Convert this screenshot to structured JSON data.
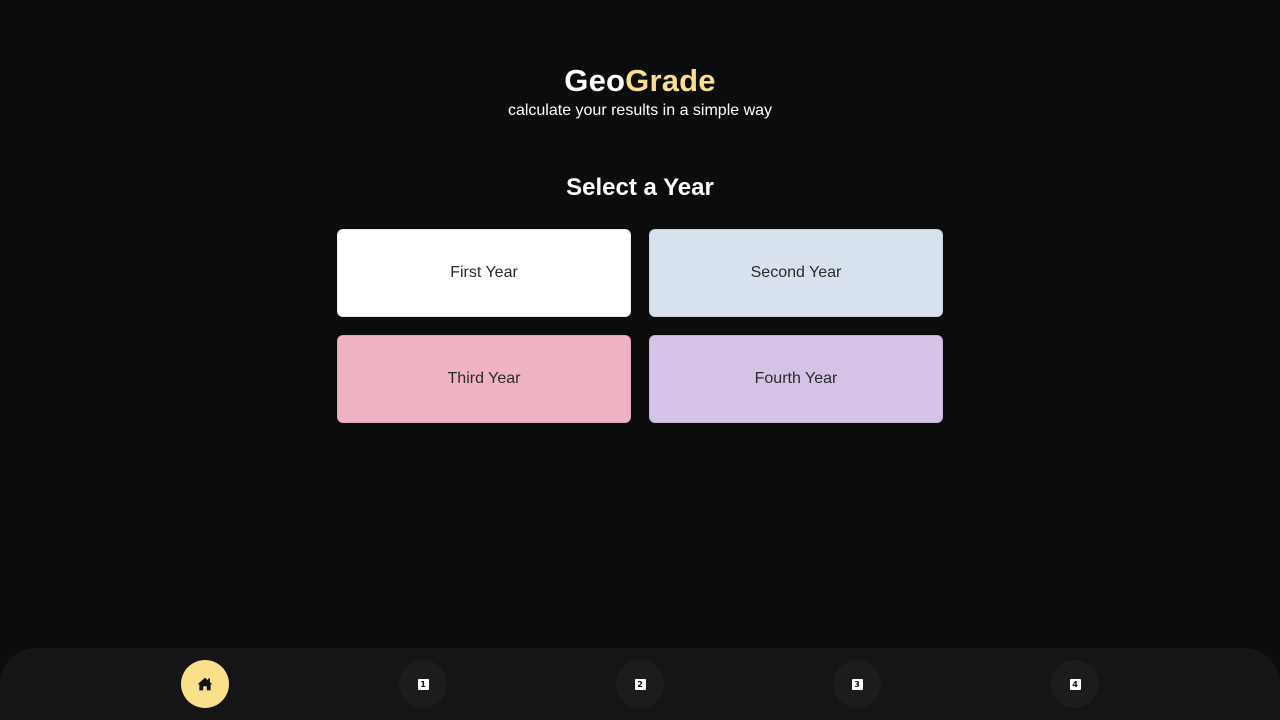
{
  "header": {
    "brand_part_a": "Geo",
    "brand_part_b": "Grade",
    "tagline": "calculate your results in a simple way"
  },
  "main": {
    "section_title": "Select a Year",
    "years": [
      {
        "label": "First Year",
        "color": "#ffffff"
      },
      {
        "label": "Second Year",
        "color": "#d8e2ee"
      },
      {
        "label": "Third Year",
        "color": "#f0b3c3"
      },
      {
        "label": "Fourth Year",
        "color": "#d4c3e7"
      }
    ]
  },
  "bottom_nav": {
    "items": [
      {
        "icon": "home-icon",
        "active": true
      },
      {
        "icon": "year-1-icon",
        "label": "1",
        "active": false
      },
      {
        "icon": "year-2-icon",
        "label": "2",
        "active": false
      },
      {
        "icon": "year-3-icon",
        "label": "3",
        "active": false
      },
      {
        "icon": "year-4-icon",
        "label": "4",
        "active": false
      }
    ]
  },
  "colors": {
    "background": "#0c0c0c",
    "accent": "#fae088",
    "nav_bar": "#151515",
    "nav_button": "#1c1c1c"
  }
}
